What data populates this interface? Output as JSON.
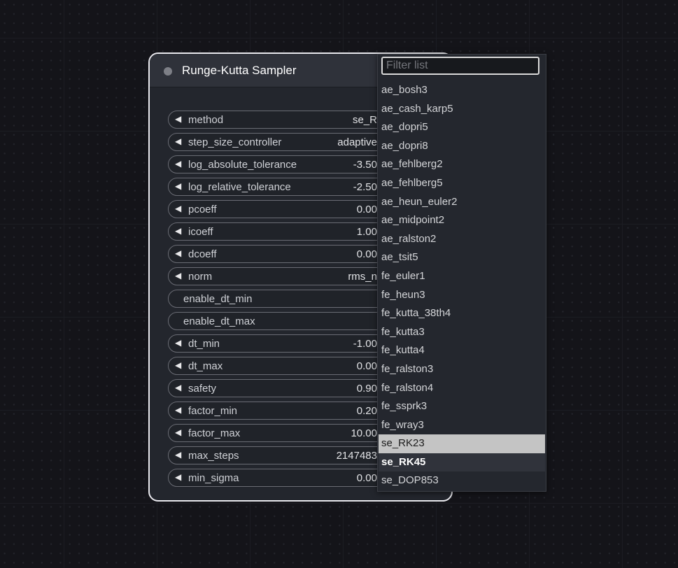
{
  "node": {
    "title": "Runge-Kutta Sampler",
    "widgets": [
      {
        "label": "method",
        "value": "se_R",
        "has_arrow": true
      },
      {
        "label": "step_size_controller",
        "value": "adaptive",
        "has_arrow": true
      },
      {
        "label": "log_absolute_tolerance",
        "value": "-3.50",
        "has_arrow": true
      },
      {
        "label": "log_relative_tolerance",
        "value": "-2.50",
        "has_arrow": true
      },
      {
        "label": "pcoeff",
        "value": "0.00",
        "has_arrow": true
      },
      {
        "label": "icoeff",
        "value": "1.00",
        "has_arrow": true
      },
      {
        "label": "dcoeff",
        "value": "0.00",
        "has_arrow": true
      },
      {
        "label": "norm",
        "value": "rms_n",
        "has_arrow": true
      },
      {
        "label": "enable_dt_min",
        "value": "",
        "has_arrow": false
      },
      {
        "label": "enable_dt_max",
        "value": "",
        "has_arrow": false
      },
      {
        "label": "dt_min",
        "value": "-1.00",
        "has_arrow": true
      },
      {
        "label": "dt_max",
        "value": "0.00",
        "has_arrow": true
      },
      {
        "label": "safety",
        "value": "0.90",
        "has_arrow": true
      },
      {
        "label": "factor_min",
        "value": "0.20",
        "has_arrow": true
      },
      {
        "label": "factor_max",
        "value": "10.00",
        "has_arrow": true
      },
      {
        "label": "max_steps",
        "value": "2147483",
        "has_arrow": true
      },
      {
        "label": "min_sigma",
        "value": "0.00",
        "has_arrow": true
      }
    ]
  },
  "dropdown": {
    "filter_placeholder": "Filter list",
    "filter_value": "",
    "options": [
      "ae_bosh3",
      "ae_cash_karp5",
      "ae_dopri5",
      "ae_dopri8",
      "ae_fehlberg2",
      "ae_fehlberg5",
      "ae_heun_euler2",
      "ae_midpoint2",
      "ae_ralston2",
      "ae_tsit5",
      "fe_euler1",
      "fe_heun3",
      "fe_kutta_38th4",
      "fe_kutta3",
      "fe_kutta4",
      "fe_ralston3",
      "fe_ralston4",
      "fe_ssprk3",
      "fe_wray3",
      "se_RK23",
      "se_RK45",
      "se_DOP853"
    ],
    "highlighted": "se_RK23",
    "selected": "se_RK45"
  },
  "colors": {
    "node_border": "#e9e9ee",
    "highlight_bg": "#c4c4c4",
    "selected_bg": "#30333b"
  },
  "icons": {
    "widget_arrow": "decrement-arrow-icon",
    "node_status": "status-dot-icon"
  }
}
